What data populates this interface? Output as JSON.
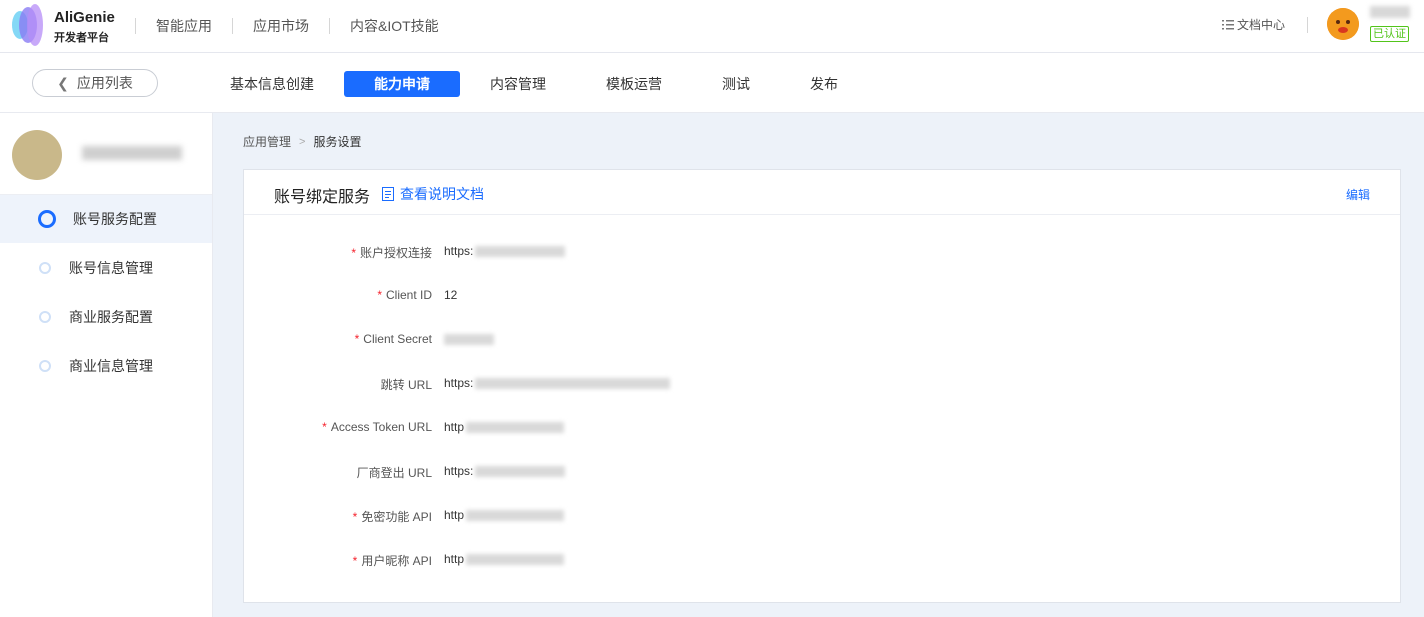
{
  "header": {
    "logo_title": "AliGenie",
    "logo_subtitle": "开发者平台",
    "nav": [
      "智能应用",
      "应用市场",
      "内容&IOT技能"
    ],
    "docs_label": "文档中心",
    "verified_badge": "已认证"
  },
  "subbar": {
    "back_label": "应用列表",
    "tabs": [
      {
        "label": "基本信息创建",
        "active": false
      },
      {
        "label": "能力申请",
        "active": true
      },
      {
        "label": "内容管理",
        "active": false
      },
      {
        "label": "模板运营",
        "active": false
      },
      {
        "label": "测试",
        "active": false
      },
      {
        "label": "发布",
        "active": false
      }
    ]
  },
  "sidebar": {
    "items": [
      {
        "label": "账号服务配置",
        "active": true
      },
      {
        "label": "账号信息管理",
        "active": false
      },
      {
        "label": "商业服务配置",
        "active": false
      },
      {
        "label": "商业信息管理",
        "active": false
      }
    ]
  },
  "breadcrumb": {
    "parent": "应用管理",
    "separator": ">",
    "current": "服务设置"
  },
  "card": {
    "title": "账号绑定服务",
    "doc_link": "查看说明文档",
    "edit_label": "编辑",
    "fields": [
      {
        "label": "账户授权连接",
        "required": true,
        "value": "https:"
      },
      {
        "label": "Client ID",
        "required": true,
        "value": "12"
      },
      {
        "label": "Client Secret",
        "required": true,
        "value": ""
      },
      {
        "label": "跳转 URL",
        "required": false,
        "value": "https:"
      },
      {
        "label": "Access Token URL",
        "required": true,
        "value": "http"
      },
      {
        "label": "厂商登出 URL",
        "required": false,
        "value": "https:"
      },
      {
        "label": "免密功能 API",
        "required": true,
        "value": "http"
      },
      {
        "label": "用户昵称 API",
        "required": true,
        "value": "http"
      }
    ]
  },
  "colors": {
    "accent": "#1a6cff",
    "required": "#f5222d",
    "verified": "#52c41a",
    "content_bg": "#edf2f9"
  }
}
